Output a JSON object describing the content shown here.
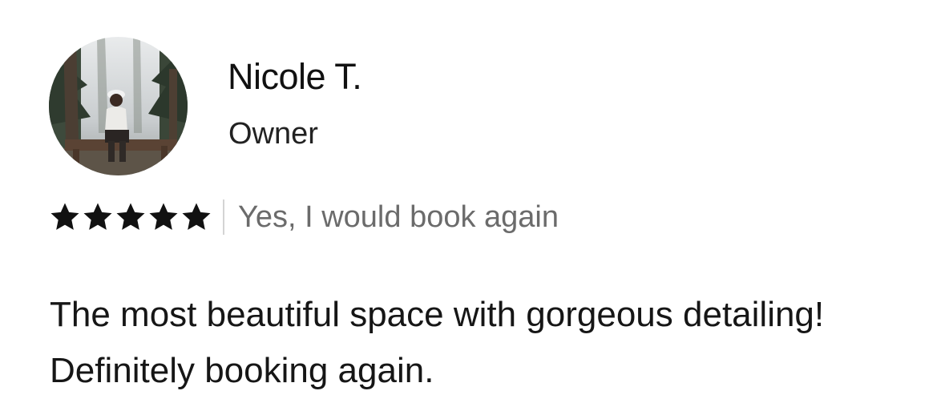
{
  "review": {
    "reviewer_name": "Nicole T.",
    "reviewer_role": "Owner",
    "rating": 5,
    "rating_max": 5,
    "recommendation": "Yes, I would book again",
    "body": "The most beautiful space with gorgeous detailing! Definitely booking again."
  },
  "icons": {
    "avatar": "reviewer-photo",
    "star": "star-icon"
  },
  "colors": {
    "star": "#111111",
    "muted_text": "#6b6b6b",
    "divider": "#d4d4d4"
  }
}
